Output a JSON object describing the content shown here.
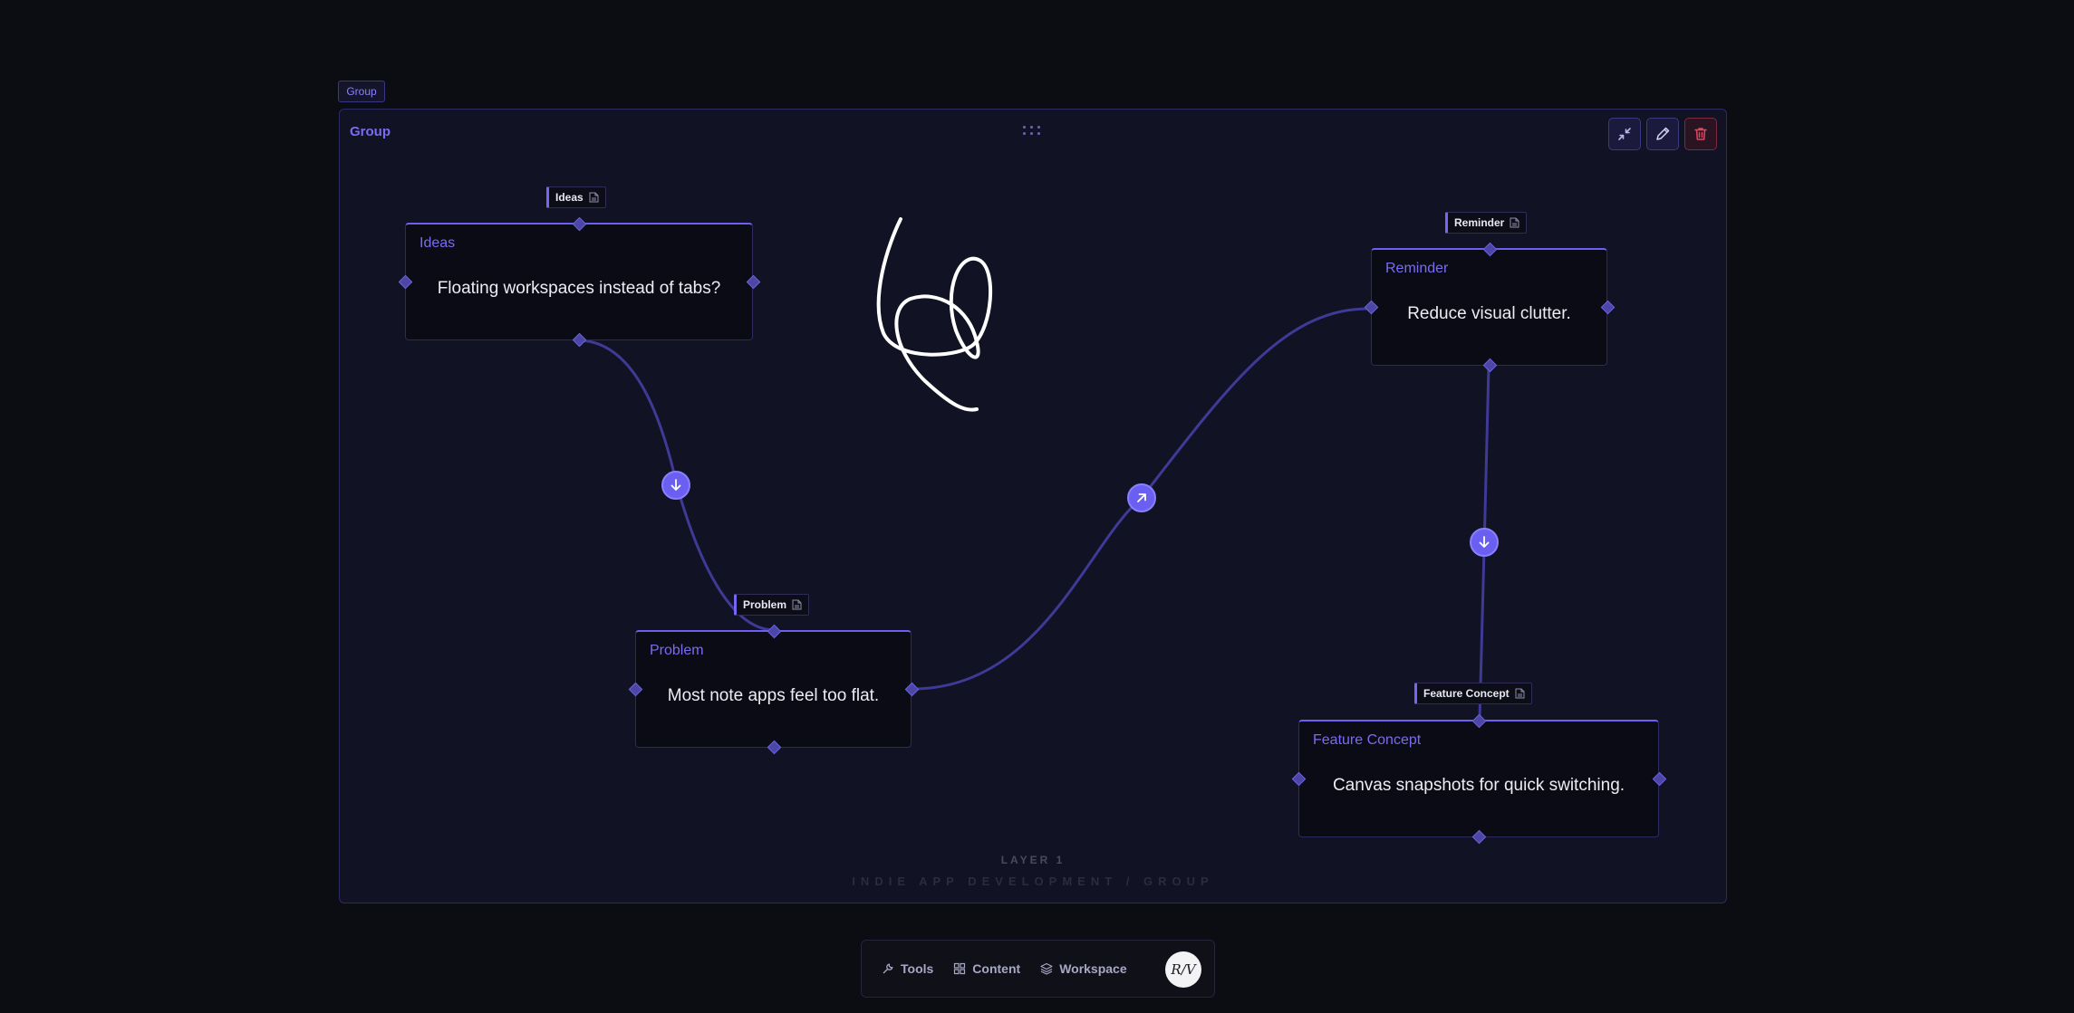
{
  "group": {
    "tag_label": "Group",
    "title": "Group",
    "layer_label": "LAYER 1",
    "breadcrumb": "INDIE APP DEVELOPMENT / GROUP",
    "actions": [
      "collapse-icon",
      "pencil-icon",
      "trash-icon"
    ]
  },
  "nodes": [
    {
      "id": "ideas",
      "tag": "Ideas",
      "title": "Ideas",
      "body": "Floating workspaces instead of tabs?"
    },
    {
      "id": "problem",
      "tag": "Problem",
      "title": "Problem",
      "body": "Most note apps feel too flat."
    },
    {
      "id": "reminder",
      "tag": "Reminder",
      "title": "Reminder",
      "body": "Reduce visual clutter."
    },
    {
      "id": "feature",
      "tag": "Feature Concept",
      "title": "Feature Concept",
      "body": "Canvas snapshots for quick switching."
    }
  ],
  "edges": [
    {
      "from": "Ideas",
      "to": "Problem",
      "badge_icon": "arrow-down-icon"
    },
    {
      "from": "Problem",
      "to": "Reminder",
      "badge_icon": "arrow-up-right-icon"
    },
    {
      "from": "Reminder",
      "to": "Feature Concept",
      "badge_icon": "arrow-down-icon"
    }
  ],
  "dock": {
    "tools": "Tools",
    "content": "Content",
    "workspace": "Workspace",
    "avatar": "R/V"
  },
  "colors": {
    "accent": "#7566f4",
    "edge": "#3e3a96",
    "background": "#0c0d12",
    "group_fill": "#111224",
    "delete": "#e0475f"
  }
}
